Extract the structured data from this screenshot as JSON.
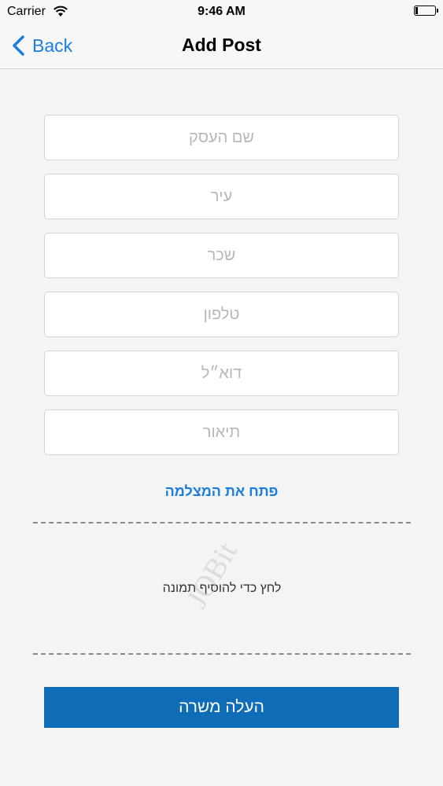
{
  "status_bar": {
    "carrier": "Carrier",
    "time": "9:46 AM",
    "battery_level": 0.15
  },
  "nav": {
    "back_label": "Back",
    "title": "Add Post"
  },
  "form": {
    "business_name_placeholder": "שם העסק",
    "city_placeholder": "עיר",
    "salary_placeholder": "שכר",
    "phone_placeholder": "טלפון",
    "email_placeholder": "דוא״ל",
    "description_placeholder": "תיאור"
  },
  "camera_link": "פתח את המצלמה",
  "photo_hint": "לחץ כדי להוסיף תמונה",
  "watermark": "JOBit",
  "submit_label": "העלה משרה",
  "colors": {
    "accent": "#1a7de0",
    "button": "#0f6db8",
    "background": "#f4f4f5"
  }
}
